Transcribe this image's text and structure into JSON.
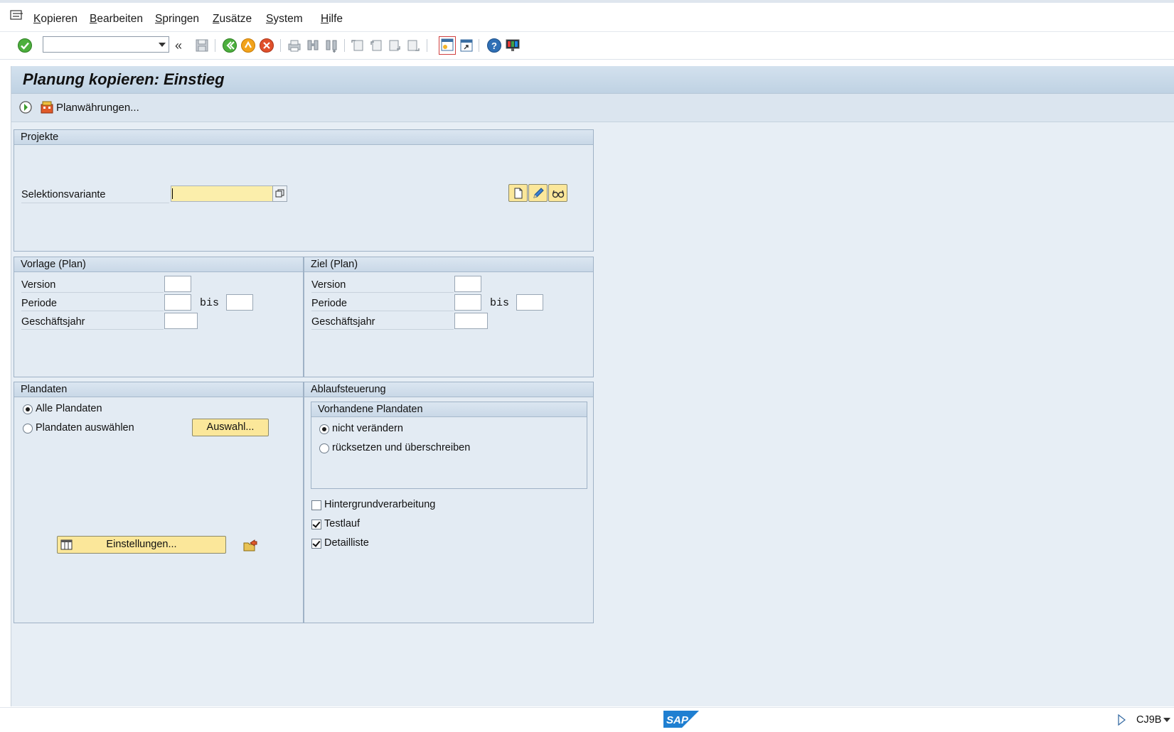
{
  "menubar": {
    "items": [
      {
        "label": "Kopieren",
        "underline": "K",
        "rest": "opieren"
      },
      {
        "label": "Bearbeiten",
        "underline": "B",
        "rest": "earbeiten"
      },
      {
        "label": "Springen",
        "underline": "S",
        "rest": "pringen"
      },
      {
        "label": "Zusätze",
        "underline": "Z",
        "rest": "usätze"
      },
      {
        "label": "System",
        "underline": "S",
        "rest": "ystem"
      },
      {
        "label": "Hilfe",
        "underline": "H",
        "rest": "ilfe"
      }
    ]
  },
  "toolbar": {
    "command_field": "",
    "icons": [
      "enter-icon",
      "save-icon",
      "back-icon",
      "exit-icon",
      "cancel-icon",
      "print-icon",
      "find-icon",
      "find-next-icon",
      "first-page-icon",
      "previous-page-icon",
      "next-page-icon",
      "last-page-icon",
      "new-session-icon",
      "shortcut-icon",
      "help-icon",
      "layout-icon"
    ]
  },
  "screen": {
    "title": "Planung kopieren: Einstieg",
    "app_toolbar": {
      "plan_currencies_label": "Planwährungen..."
    }
  },
  "projekte": {
    "header": "Projekte",
    "selection_variant_label": "Selektionsvariante",
    "selection_variant_value": ""
  },
  "vorlage": {
    "header": "Vorlage (Plan)",
    "version_label": "Version",
    "periode_label": "Periode",
    "bis_label": "bis",
    "geschaeftsjahr_label": "Geschäftsjahr"
  },
  "ziel": {
    "header": "Ziel (Plan)",
    "version_label": "Version",
    "periode_label": "Periode",
    "bis_label": "bis",
    "geschaeftsjahr_label": "Geschäftsjahr"
  },
  "plandaten": {
    "header": "Plandaten",
    "option_all": "Alle Plandaten",
    "option_select": "Plandaten auswählen",
    "selected": "all",
    "auswahl_button": "Auswahl...",
    "einstellungen_button": "Einstellungen..."
  },
  "ablauf": {
    "header": "Ablaufsteuerung",
    "vorhandene_header": "Vorhandene Plandaten",
    "option_keep": "nicht verändern",
    "option_reset": "rücksetzen und überschreiben",
    "selected": "keep",
    "background_label": "Hintergrundverarbeitung",
    "background_checked": false,
    "testlauf_label": "Testlauf",
    "testlauf_checked": true,
    "detailliste_label": "Detailliste",
    "detailliste_checked": true
  },
  "statusbar": {
    "transaction": "CJ9B"
  }
}
